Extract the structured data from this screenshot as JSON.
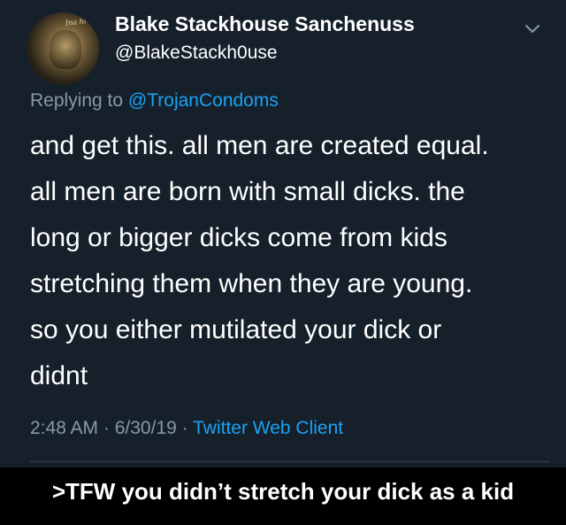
{
  "tweet": {
    "avatar_text": "Ina hrus",
    "display_name": "Blake Stackhouse Sanchenuss",
    "handle": "@BlakeStackh0use",
    "replying_prefix": "Replying to ",
    "replying_to": "@TrojanCondoms",
    "text_lines": [
      "and get this. all men are created equal.",
      "all men are born with small dicks. the",
      "long or bigger dicks come from kids",
      "stretching them when they are young.",
      "so you either mutilated your dick or",
      "didnt"
    ],
    "time": "2:48 AM",
    "date": "6/30/19",
    "separator": " · ",
    "client": "Twitter Web Client",
    "menu_icon": "chevron-down-icon"
  },
  "caption": ">TFW you didn’t stretch your dick as a kid",
  "colors": {
    "background": "#15202b",
    "accent": "#1da1f2",
    "muted": "#8899a6",
    "caption_bg": "#000000"
  }
}
